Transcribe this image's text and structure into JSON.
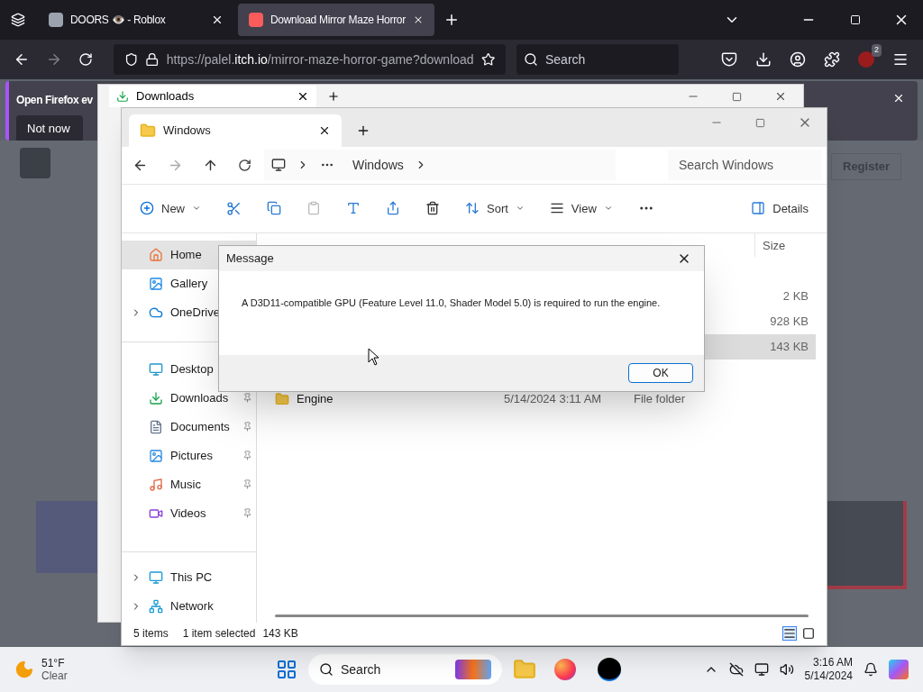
{
  "browser": {
    "tabs": [
      {
        "title": "DOORS 👁️ - Roblox",
        "selected": false
      },
      {
        "title": "Download Mirror Maze Horror",
        "selected": true
      }
    ],
    "url_prefix": "https://palel.",
    "url_domain": "itch.io",
    "url_rest": "/mirror-maze-horror-game?download",
    "search_placeholder": "Search",
    "extension_badge": "2"
  },
  "banner": {
    "text": "Open Firefox ev",
    "button": "Not now"
  },
  "site": {
    "register": "Register"
  },
  "downloads_window": {
    "tab": "Downloads"
  },
  "explorer": {
    "tab": "Windows",
    "breadcrumb": "Windows",
    "search_placeholder": "Search Windows",
    "toolbar": {
      "new": "New",
      "sort": "Sort",
      "view": "View",
      "details": "Details"
    },
    "sidebar": [
      [
        {
          "label": "Home",
          "kind": "home",
          "selected": true,
          "pinned": false,
          "expandable": false
        },
        {
          "label": "Gallery",
          "kind": "gallery",
          "selected": false,
          "pinned": false,
          "expandable": false
        },
        {
          "label": "OneDrive",
          "kind": "cloud",
          "selected": false,
          "pinned": false,
          "expandable": true
        }
      ],
      [
        {
          "label": "Desktop",
          "kind": "desktop",
          "selected": false,
          "pinned": false,
          "expandable": false
        },
        {
          "label": "Downloads",
          "kind": "download",
          "selected": false,
          "pinned": true,
          "expandable": false
        },
        {
          "label": "Documents",
          "kind": "document",
          "selected": false,
          "pinned": true,
          "expandable": false
        },
        {
          "label": "Pictures",
          "kind": "picture",
          "selected": false,
          "pinned": true,
          "expandable": false
        },
        {
          "label": "Music",
          "kind": "music",
          "selected": false,
          "pinned": true,
          "expandable": false
        },
        {
          "label": "Videos",
          "kind": "video",
          "selected": false,
          "pinned": true,
          "expandable": false
        }
      ],
      [
        {
          "label": "This PC",
          "kind": "computer",
          "selected": false,
          "pinned": false,
          "expandable": true
        },
        {
          "label": "Network",
          "kind": "network",
          "selected": false,
          "pinned": false,
          "expandable": true
        }
      ]
    ],
    "columns": [
      "Size"
    ],
    "rows": [
      {
        "size": "2 KB",
        "selected": false
      },
      {
        "size": "928 KB",
        "selected": false
      },
      {
        "size": "143 KB",
        "selected": true
      },
      {
        "name": "Engine",
        "date": "5/14/2024 3:11 AM",
        "type": "File folder",
        "selected": false
      }
    ],
    "status": {
      "count": "5 items",
      "selection": "1 item selected",
      "size": "143 KB"
    }
  },
  "dialog": {
    "title": "Message",
    "message": "A D3D11-compatible GPU (Feature Level 11.0, Shader Model 5.0) is required to run the engine.",
    "ok": "OK"
  },
  "taskbar": {
    "temperature": "51°F",
    "condition": "Clear",
    "search_placeholder": "Search",
    "time": "3:16 AM",
    "date": "5/14/2024"
  }
}
